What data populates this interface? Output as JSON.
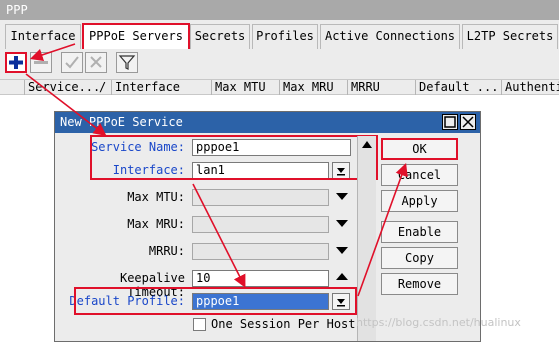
{
  "window": {
    "title": "PPP"
  },
  "tabs": [
    {
      "label": "Interface"
    },
    {
      "label": "PPPoE Servers",
      "active": true
    },
    {
      "label": "Secrets"
    },
    {
      "label": "Profiles"
    },
    {
      "label": "Active Connections"
    },
    {
      "label": "L2TP Secrets"
    }
  ],
  "toolbar": {
    "add": "+",
    "remove": "−",
    "enable": "✓",
    "disable": "✕",
    "filter": "filter-icon"
  },
  "grid": {
    "columns": [
      "Service...",
      "/",
      "Interface",
      "Max MTU",
      "Max MRU",
      "MRRU",
      "Default ...",
      "Authenti"
    ]
  },
  "dialog": {
    "title": "New PPPoE Service",
    "fields": {
      "service_name": {
        "label": "Service Name:",
        "value": "pppoe1"
      },
      "interface": {
        "label": "Interface:",
        "value": "lan1"
      },
      "max_mtu": {
        "label": "Max MTU:",
        "value": ""
      },
      "max_mru": {
        "label": "Max MRU:",
        "value": ""
      },
      "mrru": {
        "label": "MRRU:",
        "value": ""
      },
      "keepalive": {
        "label": "Keepalive Timeout:",
        "value": "10"
      },
      "default_profile": {
        "label": "Default Profile:",
        "value": "pppoe1"
      },
      "one_session": {
        "label": "One Session Per Host",
        "checked": false
      }
    },
    "buttons": {
      "ok": "OK",
      "cancel": "Cancel",
      "apply": "Apply",
      "enable": "Enable",
      "copy": "Copy",
      "remove": "Remove"
    }
  },
  "watermark": "https://blog.csdn.net/hualinux",
  "colors": {
    "highlight": "#e0102a",
    "dialog_title": "#2c62a8",
    "label_blue": "#1a47c9"
  }
}
